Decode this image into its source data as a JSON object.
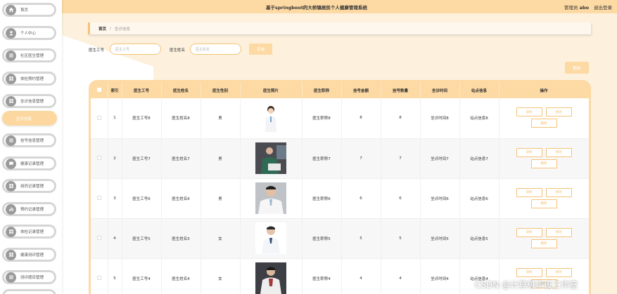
{
  "header": {
    "title": "基于springboot的大桥镇居民个人健康管理系统",
    "role_label": "管理员",
    "username": "abo",
    "logout_label": "退出登录"
  },
  "sidebar": {
    "items": [
      {
        "label": "首页",
        "icon": "home-icon",
        "active": false
      },
      {
        "label": "个人中心",
        "icon": "user-icon",
        "active": false
      },
      {
        "label": "社区医生管理",
        "icon": "list-icon",
        "active": false
      },
      {
        "label": "体检预约管理",
        "icon": "grid-icon",
        "active": false
      },
      {
        "label": "坐诊信息管理",
        "icon": "grid-icon",
        "active": false
      },
      {
        "label": "坐诊信息",
        "icon": "",
        "active": true
      },
      {
        "label": "挂号信息管理",
        "icon": "list-icon",
        "active": false
      },
      {
        "label": "健康记录管理",
        "icon": "chat-icon",
        "active": false
      },
      {
        "label": "用药记录管理",
        "icon": "grid-icon",
        "active": false
      },
      {
        "label": "预约记录管理",
        "icon": "chart-icon",
        "active": false
      },
      {
        "label": "体检记录管理",
        "icon": "grid-icon",
        "active": false
      },
      {
        "label": "健康测评管理",
        "icon": "grid-icon",
        "active": false
      },
      {
        "label": "测评题目管理",
        "icon": "list-icon",
        "active": false
      }
    ]
  },
  "breadcrumb": {
    "home": "首页",
    "separator": "/",
    "current": "坐诊信息"
  },
  "search": {
    "doctor_id_label": "医生工号",
    "doctor_id_placeholder": "医生工号",
    "doctor_name_label": "医生姓名",
    "doctor_name_placeholder": "医生姓名",
    "search_button": "查询"
  },
  "toolbar": {
    "delete_button": "删除"
  },
  "table": {
    "columns": [
      "索引",
      "医生工号",
      "医生姓名",
      "医生性别",
      "医生照片",
      "医生职称",
      "挂号金额",
      "挂号数量",
      "坐诊时间",
      "站点信息",
      "操作"
    ],
    "rows": [
      {
        "index": "1",
        "doctor_id": "医生工号8",
        "name": "医生姓名8",
        "gender": "男",
        "photo": "doctor-photo-1",
        "title": "医生职称8",
        "fee": "8",
        "count": "8",
        "time": "坐诊时间8",
        "site": "站点信息8"
      },
      {
        "index": "2",
        "doctor_id": "医生工号7",
        "name": "医生姓名7",
        "gender": "男",
        "photo": "doctor-photo-2",
        "title": "医生职称7",
        "fee": "7",
        "count": "7",
        "time": "坐诊时间7",
        "site": "站点信息7"
      },
      {
        "index": "3",
        "doctor_id": "医生工号6",
        "name": "医生姓名6",
        "gender": "男",
        "photo": "doctor-photo-3",
        "title": "医生职称6",
        "fee": "6",
        "count": "6",
        "time": "坐诊时间6",
        "site": "站点信息6"
      },
      {
        "index": "4",
        "doctor_id": "医生工号5",
        "name": "医生姓名5",
        "gender": "女",
        "photo": "doctor-photo-4",
        "title": "医生职称5",
        "fee": "5",
        "count": "5",
        "time": "坐诊时间5",
        "site": "站点信息5"
      },
      {
        "index": "5",
        "doctor_id": "医生工号4",
        "name": "医生姓名4",
        "gender": "女",
        "photo": "doctor-photo-5",
        "title": "医生职称4",
        "fee": "4",
        "count": "4",
        "time": "坐诊时间4",
        "site": "站点信息4"
      }
    ],
    "row_actions": {
      "detail": "详情",
      "edit": "修改",
      "delete": "删除"
    }
  },
  "watermark": "CSDN @计算机毕设工作室",
  "colors": {
    "accent": "#fdd9a3",
    "accent_border": "#f5c27a",
    "active_item": "#fcd8a0",
    "sidebar_border": "#d5d5d5"
  }
}
